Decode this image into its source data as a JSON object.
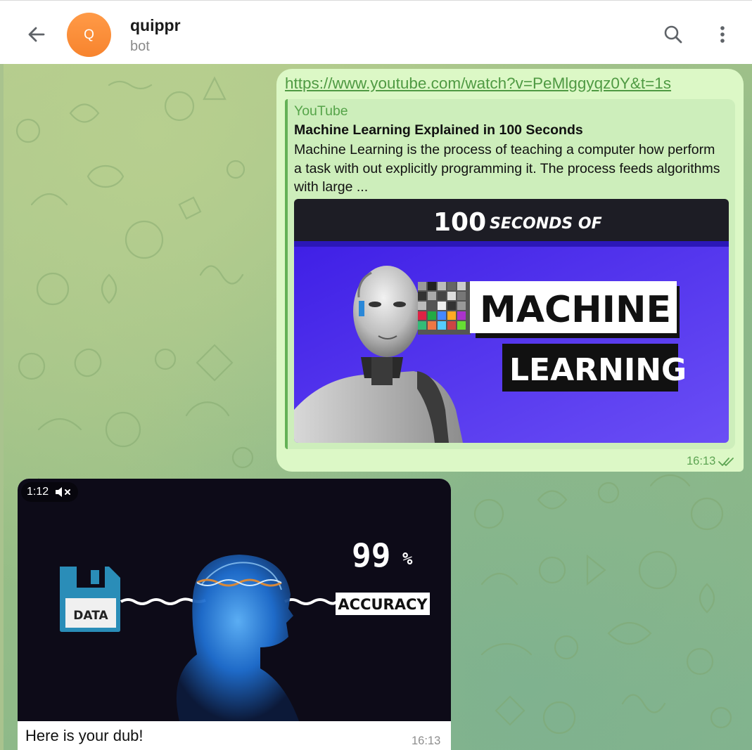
{
  "header": {
    "avatar_letter": "Q",
    "title": "quippr",
    "subtitle": "bot",
    "icons": {
      "back": "arrow-left-icon",
      "search": "search-icon",
      "more": "more-vertical-icon"
    }
  },
  "messages": [
    {
      "direction": "outgoing",
      "link": "https://www.youtube.com/watch?v=PeMlggyqz0Y&t=1s",
      "preview": {
        "site": "YouTube",
        "title": "Machine Learning Explained in 100 Seconds",
        "description": "Machine Learning is the process of teaching a computer how perform a task with out explicitly programming it. The process feeds algorithms with large ...",
        "thumbnail": {
          "top_number": "100",
          "top_text": "SECONDS OF",
          "line1": "MACHINE",
          "line2": "LEARNING"
        }
      },
      "time": "16:13",
      "status_icon": "double-check-icon"
    },
    {
      "direction": "incoming",
      "video": {
        "duration": "1:12",
        "muted_icon": "muted-speaker-icon",
        "label_data": "DATA",
        "label_percent": "99",
        "label_percent_sign": "%",
        "label_accuracy": "ACCURACY"
      },
      "caption": "Here is your dub!",
      "time": "16:13"
    }
  ],
  "colors": {
    "accent_green": "#4f9a43",
    "bubble_out": "#dcf8c6",
    "avatar": "#f7842e",
    "thumb_blue": "#4d2ef0"
  }
}
